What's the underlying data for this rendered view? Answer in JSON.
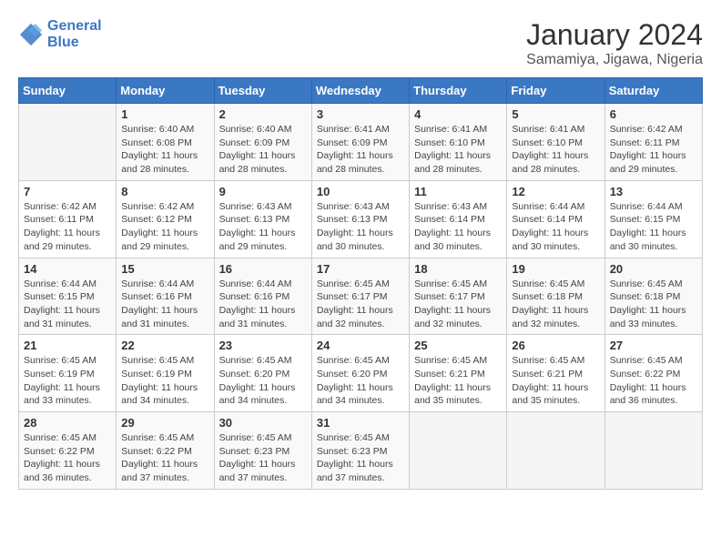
{
  "header": {
    "logo_line1": "General",
    "logo_line2": "Blue",
    "month_year": "January 2024",
    "location": "Samamiya, Jigawa, Nigeria"
  },
  "weekdays": [
    "Sunday",
    "Monday",
    "Tuesday",
    "Wednesday",
    "Thursday",
    "Friday",
    "Saturday"
  ],
  "weeks": [
    [
      {
        "day": "",
        "info": ""
      },
      {
        "day": "1",
        "info": "Sunrise: 6:40 AM\nSunset: 6:08 PM\nDaylight: 11 hours\nand 28 minutes."
      },
      {
        "day": "2",
        "info": "Sunrise: 6:40 AM\nSunset: 6:09 PM\nDaylight: 11 hours\nand 28 minutes."
      },
      {
        "day": "3",
        "info": "Sunrise: 6:41 AM\nSunset: 6:09 PM\nDaylight: 11 hours\nand 28 minutes."
      },
      {
        "day": "4",
        "info": "Sunrise: 6:41 AM\nSunset: 6:10 PM\nDaylight: 11 hours\nand 28 minutes."
      },
      {
        "day": "5",
        "info": "Sunrise: 6:41 AM\nSunset: 6:10 PM\nDaylight: 11 hours\nand 28 minutes."
      },
      {
        "day": "6",
        "info": "Sunrise: 6:42 AM\nSunset: 6:11 PM\nDaylight: 11 hours\nand 29 minutes."
      }
    ],
    [
      {
        "day": "7",
        "info": "Sunrise: 6:42 AM\nSunset: 6:11 PM\nDaylight: 11 hours\nand 29 minutes."
      },
      {
        "day": "8",
        "info": "Sunrise: 6:42 AM\nSunset: 6:12 PM\nDaylight: 11 hours\nand 29 minutes."
      },
      {
        "day": "9",
        "info": "Sunrise: 6:43 AM\nSunset: 6:13 PM\nDaylight: 11 hours\nand 29 minutes."
      },
      {
        "day": "10",
        "info": "Sunrise: 6:43 AM\nSunset: 6:13 PM\nDaylight: 11 hours\nand 30 minutes."
      },
      {
        "day": "11",
        "info": "Sunrise: 6:43 AM\nSunset: 6:14 PM\nDaylight: 11 hours\nand 30 minutes."
      },
      {
        "day": "12",
        "info": "Sunrise: 6:44 AM\nSunset: 6:14 PM\nDaylight: 11 hours\nand 30 minutes."
      },
      {
        "day": "13",
        "info": "Sunrise: 6:44 AM\nSunset: 6:15 PM\nDaylight: 11 hours\nand 30 minutes."
      }
    ],
    [
      {
        "day": "14",
        "info": "Sunrise: 6:44 AM\nSunset: 6:15 PM\nDaylight: 11 hours\nand 31 minutes."
      },
      {
        "day": "15",
        "info": "Sunrise: 6:44 AM\nSunset: 6:16 PM\nDaylight: 11 hours\nand 31 minutes."
      },
      {
        "day": "16",
        "info": "Sunrise: 6:44 AM\nSunset: 6:16 PM\nDaylight: 11 hours\nand 31 minutes."
      },
      {
        "day": "17",
        "info": "Sunrise: 6:45 AM\nSunset: 6:17 PM\nDaylight: 11 hours\nand 32 minutes."
      },
      {
        "day": "18",
        "info": "Sunrise: 6:45 AM\nSunset: 6:17 PM\nDaylight: 11 hours\nand 32 minutes."
      },
      {
        "day": "19",
        "info": "Sunrise: 6:45 AM\nSunset: 6:18 PM\nDaylight: 11 hours\nand 32 minutes."
      },
      {
        "day": "20",
        "info": "Sunrise: 6:45 AM\nSunset: 6:18 PM\nDaylight: 11 hours\nand 33 minutes."
      }
    ],
    [
      {
        "day": "21",
        "info": "Sunrise: 6:45 AM\nSunset: 6:19 PM\nDaylight: 11 hours\nand 33 minutes."
      },
      {
        "day": "22",
        "info": "Sunrise: 6:45 AM\nSunset: 6:19 PM\nDaylight: 11 hours\nand 34 minutes."
      },
      {
        "day": "23",
        "info": "Sunrise: 6:45 AM\nSunset: 6:20 PM\nDaylight: 11 hours\nand 34 minutes."
      },
      {
        "day": "24",
        "info": "Sunrise: 6:45 AM\nSunset: 6:20 PM\nDaylight: 11 hours\nand 34 minutes."
      },
      {
        "day": "25",
        "info": "Sunrise: 6:45 AM\nSunset: 6:21 PM\nDaylight: 11 hours\nand 35 minutes."
      },
      {
        "day": "26",
        "info": "Sunrise: 6:45 AM\nSunset: 6:21 PM\nDaylight: 11 hours\nand 35 minutes."
      },
      {
        "day": "27",
        "info": "Sunrise: 6:45 AM\nSunset: 6:22 PM\nDaylight: 11 hours\nand 36 minutes."
      }
    ],
    [
      {
        "day": "28",
        "info": "Sunrise: 6:45 AM\nSunset: 6:22 PM\nDaylight: 11 hours\nand 36 minutes."
      },
      {
        "day": "29",
        "info": "Sunrise: 6:45 AM\nSunset: 6:22 PM\nDaylight: 11 hours\nand 37 minutes."
      },
      {
        "day": "30",
        "info": "Sunrise: 6:45 AM\nSunset: 6:23 PM\nDaylight: 11 hours\nand 37 minutes."
      },
      {
        "day": "31",
        "info": "Sunrise: 6:45 AM\nSunset: 6:23 PM\nDaylight: 11 hours\nand 37 minutes."
      },
      {
        "day": "",
        "info": ""
      },
      {
        "day": "",
        "info": ""
      },
      {
        "day": "",
        "info": ""
      }
    ]
  ]
}
